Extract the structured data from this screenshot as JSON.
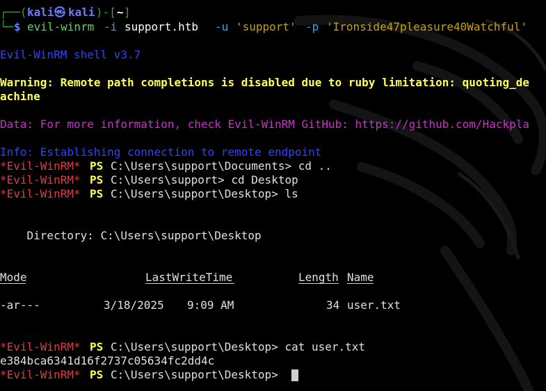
{
  "prompt": {
    "box_top": "┌──(",
    "user": "kali",
    "at_symbol": "㉿",
    "host": "kali",
    "bracket_mid": ")-[",
    "cwd": "~",
    "bracket_end": "]",
    "box_bottom": "└─",
    "dollar": "$",
    "command": "evil-winrm",
    "opt_i": "-i",
    "host_arg": "support.htb",
    "opt_u": "-u",
    "user_arg": "'support'",
    "opt_p": "-p",
    "pass_arg": "'Ironside47pleasure40Watchful'"
  },
  "banner": "Evil-WinRM shell v3.7",
  "warning_line1": "Warning: Remote path completions is disabled due to ruby limitation: quoting_de",
  "warning_line2": "achine",
  "data_line": "Data: For more information, check Evil-WinRM GitHub: https://github.com/Hackpla",
  "info_line": "Info: Establishing connection to remote endpoint",
  "session": {
    "tag": "*Evil-WinRM*",
    "ps": "PS",
    "cmd1": "C:\\Users\\support\\Documents> cd ..",
    "cmd2": "C:\\Users\\support> cd Desktop",
    "cmd3": "C:\\Users\\support\\Desktop> ls",
    "cmd4": "C:\\Users\\support\\Desktop> cat user.txt",
    "cmd5": "C:\\Users\\support\\Desktop> "
  },
  "directory_line": "    Directory: C:\\Users\\support\\Desktop",
  "listing": {
    "headers": [
      "Mode",
      "LastWriteTime",
      "Length",
      "Name"
    ],
    "row": {
      "mode": "-ar---",
      "date": "3/18/2025",
      "time": "9:09 AM",
      "length": "34",
      "name": "user.txt"
    }
  },
  "file_content": "e384bca6341d16f2737c05634fc2dd4c",
  "colors": {
    "background": "#000000",
    "prompt_green": "#3aa33a",
    "kali_blue": "#6a7dfc",
    "winrm_red": "#e43b3b",
    "ps_yellow": "#ffff55",
    "warning_yellow": "#ffff55",
    "data_magenta": "#cc2fcc",
    "info_blue": "#2d44ff"
  }
}
